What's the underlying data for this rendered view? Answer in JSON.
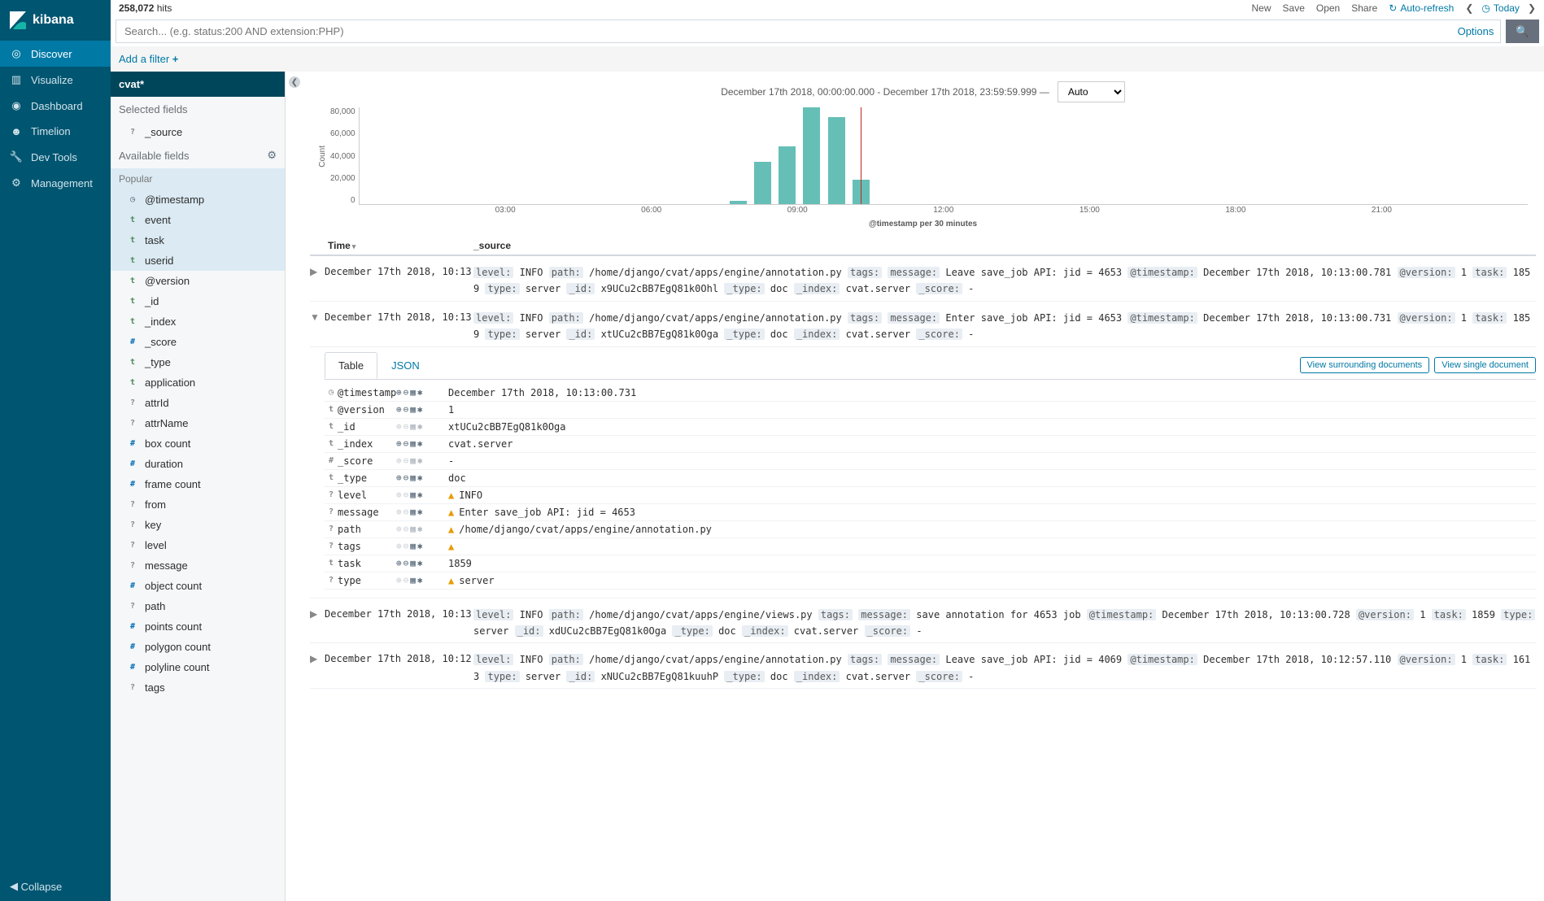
{
  "brand": "kibana",
  "nav": {
    "discover": "Discover",
    "visualize": "Visualize",
    "dashboard": "Dashboard",
    "timelion": "Timelion",
    "devtools": "Dev Tools",
    "management": "Management",
    "collapse": "Collapse"
  },
  "hits": {
    "count": "258,072",
    "label": "hits"
  },
  "toplinks": {
    "new": "New",
    "save": "Save",
    "open": "Open",
    "share": "Share",
    "autorefresh": "Auto-refresh",
    "today": "Today"
  },
  "search": {
    "placeholder": "Search... (e.g. status:200 AND extension:PHP)",
    "options": "Options"
  },
  "filter": {
    "add": "Add a filter",
    "plus": "+"
  },
  "index": {
    "pattern": "cvat*"
  },
  "fields": {
    "selected_hdr": "Selected fields",
    "selected": [
      {
        "t": "?",
        "n": "_source"
      }
    ],
    "available_hdr": "Available fields",
    "popular_hdr": "Popular",
    "popular": [
      {
        "t": "clock",
        "n": "@timestamp"
      },
      {
        "t": "t",
        "n": "event"
      },
      {
        "t": "t",
        "n": "task"
      },
      {
        "t": "t",
        "n": "userid"
      }
    ],
    "rest": [
      {
        "t": "t",
        "n": "@version"
      },
      {
        "t": "t",
        "n": "_id"
      },
      {
        "t": "t",
        "n": "_index"
      },
      {
        "t": "#",
        "n": "_score"
      },
      {
        "t": "t",
        "n": "_type"
      },
      {
        "t": "t",
        "n": "application"
      },
      {
        "t": "?",
        "n": "attrId"
      },
      {
        "t": "?",
        "n": "attrName"
      },
      {
        "t": "#",
        "n": "box count"
      },
      {
        "t": "#",
        "n": "duration"
      },
      {
        "t": "#",
        "n": "frame count"
      },
      {
        "t": "?",
        "n": "from"
      },
      {
        "t": "?",
        "n": "key"
      },
      {
        "t": "?",
        "n": "level"
      },
      {
        "t": "?",
        "n": "message"
      },
      {
        "t": "#",
        "n": "object count"
      },
      {
        "t": "?",
        "n": "path"
      },
      {
        "t": "#",
        "n": "points count"
      },
      {
        "t": "#",
        "n": "polygon count"
      },
      {
        "t": "#",
        "n": "polyline count"
      },
      {
        "t": "?",
        "n": "tags"
      }
    ]
  },
  "daterange": {
    "text": "December 17th 2018, 00:00:00.000 - December 17th 2018, 23:59:59.999 —",
    "interval": "Auto"
  },
  "chart_data": {
    "type": "bar",
    "title": "",
    "ylabel": "Count",
    "xlabel": "@timestamp per 30 minutes",
    "ylim": [
      0,
      80000
    ],
    "yticks": [
      "80,000",
      "60,000",
      "40,000",
      "20,000",
      "0"
    ],
    "xticks": [
      {
        "pos": 12.5,
        "label": "03:00"
      },
      {
        "pos": 25.0,
        "label": "06:00"
      },
      {
        "pos": 37.5,
        "label": "09:00"
      },
      {
        "pos": 50.0,
        "label": "12:00"
      },
      {
        "pos": 62.5,
        "label": "15:00"
      },
      {
        "pos": 75.0,
        "label": "18:00"
      },
      {
        "pos": 87.5,
        "label": "21:00"
      }
    ],
    "bars": [
      {
        "pos": 31.7,
        "value": 3000
      },
      {
        "pos": 33.8,
        "value": 35000
      },
      {
        "pos": 35.9,
        "value": 48000
      },
      {
        "pos": 38.0,
        "value": 80000
      },
      {
        "pos": 40.1,
        "value": 72000
      },
      {
        "pos": 42.2,
        "value": 20000
      }
    ],
    "redline_pos": 42.9
  },
  "table": {
    "hdr_time": "Time",
    "hdr_source": "_source",
    "rows": [
      {
        "expand": "▶",
        "time": "December 17th 2018, 10:13:00.781",
        "src": [
          [
            "level:",
            "INFO"
          ],
          [
            "path:",
            "/home/django/cvat/apps/engine/annotation.py"
          ],
          [
            "tags:",
            ""
          ],
          [
            "message:",
            "Leave save_job API: jid = 4653"
          ],
          [
            "@timestamp:",
            "December 17th 2018, 10:13:00.781"
          ],
          [
            "@version:",
            "1"
          ],
          [
            "task:",
            "1859"
          ],
          [
            "type:",
            "server"
          ],
          [
            "_id:",
            "x9UCu2cBB7EgQ81k0Ohl"
          ],
          [
            "_type:",
            "doc"
          ],
          [
            "_index:",
            "cvat.server"
          ],
          [
            "_score:",
            "-"
          ]
        ]
      },
      {
        "expand": "▼",
        "time": "December 17th 2018, 10:13:00.731",
        "src": [
          [
            "level:",
            "INFO"
          ],
          [
            "path:",
            "/home/django/cvat/apps/engine/annotation.py"
          ],
          [
            "tags:",
            ""
          ],
          [
            "message:",
            "Enter save_job API: jid = 4653"
          ],
          [
            "@timestamp:",
            "December 17th 2018, 10:13:00.731"
          ],
          [
            "@version:",
            "1"
          ],
          [
            "task:",
            "1859"
          ],
          [
            "type:",
            "server"
          ],
          [
            "_id:",
            "xtUCu2cBB7EgQ81k0Oga"
          ],
          [
            "_type:",
            "doc"
          ],
          [
            "_index:",
            "cvat.server"
          ],
          [
            "_score:",
            "-"
          ]
        ]
      }
    ],
    "below_rows": [
      {
        "time": "December 17th 2018, 10:13:00.728",
        "src": [
          [
            "level:",
            "INFO"
          ],
          [
            "path:",
            "/home/django/cvat/apps/engine/views.py"
          ],
          [
            "tags:",
            ""
          ],
          [
            "message:",
            "save annotation for 4653 job"
          ],
          [
            "@timestamp:",
            "December 17th 2018, 10:13:00.728"
          ],
          [
            "@version:",
            "1"
          ],
          [
            "task:",
            "1859"
          ],
          [
            "type:",
            "server"
          ],
          [
            "_id:",
            "xdUCu2cBB7EgQ81k0Oga"
          ],
          [
            "_type:",
            "doc"
          ],
          [
            "_index:",
            "cvat.server"
          ],
          [
            "_score:",
            "-"
          ]
        ]
      },
      {
        "time": "December 17th 2018, 10:12:57.110",
        "src": [
          [
            "level:",
            "INFO"
          ],
          [
            "path:",
            "/home/django/cvat/apps/engine/annotation.py"
          ],
          [
            "tags:",
            ""
          ],
          [
            "message:",
            "Leave save_job API: jid = 4069"
          ],
          [
            "@timestamp:",
            "December 17th 2018, 10:12:57.110"
          ],
          [
            "@version:",
            "1"
          ],
          [
            "task:",
            "1613"
          ],
          [
            "type:",
            "server"
          ],
          [
            "_id:",
            "xNUCu2cBB7EgQ81kuuhP"
          ],
          [
            "_type:",
            "doc"
          ],
          [
            "_index:",
            "cvat.server"
          ],
          [
            "_score:",
            "-"
          ]
        ]
      }
    ]
  },
  "expanded": {
    "tabs": {
      "table": "Table",
      "json": "JSON"
    },
    "surrounding": "View surrounding documents",
    "single": "View single document",
    "rows": [
      {
        "t": "clock",
        "name": "@timestamp",
        "acts": "on",
        "warn": false,
        "val": "December 17th 2018, 10:13:00.731"
      },
      {
        "t": "t",
        "name": "@version",
        "acts": "on",
        "warn": false,
        "val": "1"
      },
      {
        "t": "t",
        "name": "_id",
        "acts": "off",
        "warn": false,
        "val": "xtUCu2cBB7EgQ81k0Oga"
      },
      {
        "t": "t",
        "name": "_index",
        "acts": "on",
        "warn": false,
        "val": "cvat.server"
      },
      {
        "t": "#",
        "name": "_score",
        "acts": "off",
        "warn": false,
        "val": "-"
      },
      {
        "t": "t",
        "name": "_type",
        "acts": "on",
        "warn": false,
        "val": "doc"
      },
      {
        "t": "?",
        "name": "level",
        "acts": "partial",
        "warn": true,
        "val": "INFO"
      },
      {
        "t": "?",
        "name": "message",
        "acts": "partial",
        "warn": true,
        "val": "Enter save_job API: jid = 4653"
      },
      {
        "t": "?",
        "name": "path",
        "acts": "off",
        "warn": true,
        "val": "/home/django/cvat/apps/engine/annotation.py"
      },
      {
        "t": "?",
        "name": "tags",
        "acts": "partial",
        "warn": true,
        "val": ""
      },
      {
        "t": "t",
        "name": "task",
        "acts": "on",
        "warn": false,
        "val": "1859"
      },
      {
        "t": "?",
        "name": "type",
        "acts": "partial",
        "warn": true,
        "val": "server"
      }
    ]
  }
}
